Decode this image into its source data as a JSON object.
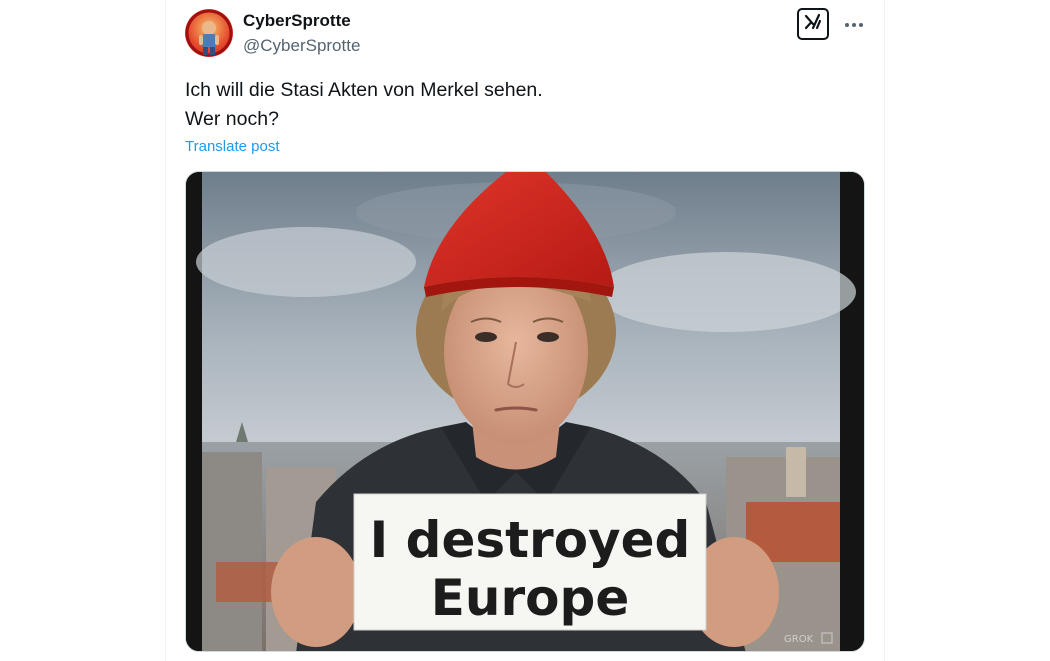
{
  "post": {
    "author": {
      "display_name": "CyberSprotte",
      "handle": "@CyberSprotte",
      "avatar_icon": "avatar-image"
    },
    "text_lines": [
      "Ich will die Stasi Akten von Merkel sehen.",
      "Wer noch?"
    ],
    "translate_label": "Translate post",
    "media": {
      "sign_text_line1": "I destroyed",
      "sign_text_line2": "Europe",
      "watermark": "GROK"
    },
    "actions": {
      "grok_icon": "grok-icon",
      "more_icon": "more-options-icon"
    }
  },
  "colors": {
    "text_primary": "#0f1419",
    "text_secondary": "#536471",
    "link": "#1d9bf0",
    "border": "#eff3f4",
    "hat_red": "#d8261e"
  }
}
